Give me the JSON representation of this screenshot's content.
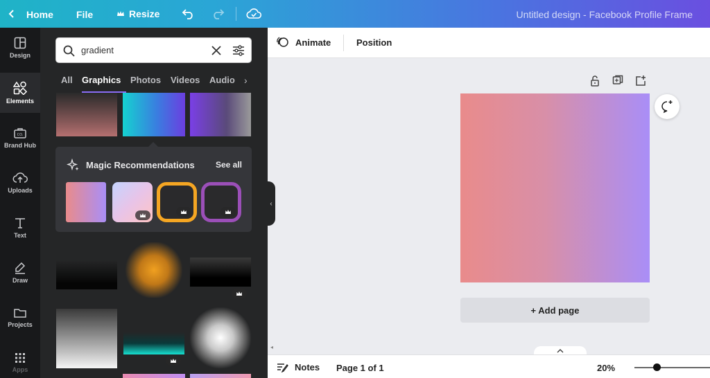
{
  "topbar": {
    "home_label": "Home",
    "file_label": "File",
    "resize_label": "Resize",
    "title": "Untitled design - Facebook Profile Frame"
  },
  "rail": {
    "items": [
      {
        "label": "Design",
        "icon": "layout-icon"
      },
      {
        "label": "Elements",
        "icon": "shapes-icon"
      },
      {
        "label": "Brand Hub",
        "icon": "brand-icon"
      },
      {
        "label": "Uploads",
        "icon": "cloud-upload-icon"
      },
      {
        "label": "Text",
        "icon": "text-icon"
      },
      {
        "label": "Draw",
        "icon": "pen-icon"
      },
      {
        "label": "Projects",
        "icon": "folder-icon"
      },
      {
        "label": "Apps",
        "icon": "grid-icon"
      }
    ],
    "active": "Elements"
  },
  "search": {
    "value": "gradient"
  },
  "tabs": [
    "All",
    "Graphics",
    "Photos",
    "Videos",
    "Audio"
  ],
  "active_tab": "Graphics",
  "magic": {
    "title": "Magic Recommendations",
    "see_all": "See all"
  },
  "canvas_bar": {
    "animate_label": "Animate",
    "position_label": "Position"
  },
  "add_page_label": "+ Add page",
  "bottombar": {
    "notes_label": "Notes",
    "page_indicator": "Page 1 of 1",
    "zoom": "20%",
    "zoom_level": 0.25
  },
  "colors": {
    "accent": "#8b6cf5",
    "page_gradient_start": "#e98b8b",
    "page_gradient_end": "#a98ef7"
  }
}
